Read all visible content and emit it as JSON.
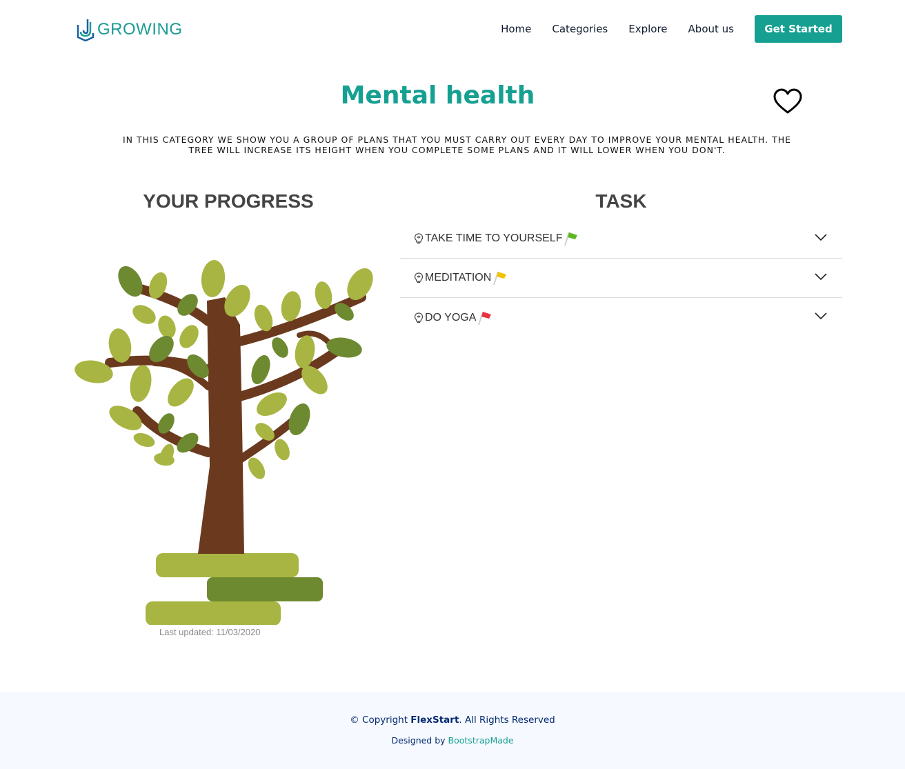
{
  "header": {
    "logo_text": "GROWING",
    "nav": [
      "Home",
      "Categories",
      "Explore",
      "About us"
    ],
    "cta_label": "Get Started"
  },
  "main": {
    "title": "Mental health",
    "intro": "IN THIS CATEGORY WE SHOW YOU A GROUP OF PLANS THAT YOU MUST CARRY OUT EVERY DAY TO IMPROVE YOUR MENTAL HEALTH. THE TREE WILL INCREASE ITS HEIGHT WHEN YOU COMPLETE SOME PLANS AND IT WILL LOWER WHEN YOU DON'T.",
    "progress_title": "YOUR PROGRESS",
    "last_updated": "Last updated: 11/03/2020",
    "task_title": "TASK",
    "tasks": [
      {
        "label": "TAKE TIME TO YOURSELF",
        "flag_color": "#5fb820",
        "icon": "brain-bulb-icon"
      },
      {
        "label": "MEDITATION",
        "flag_color": "#f2c300",
        "icon": "brain-bulb-icon"
      },
      {
        "label": "DO YOGA",
        "flag_color": "#e8343f",
        "icon": "brain-bulb-icon"
      }
    ]
  },
  "footer": {
    "copyright_prefix": "© Copyright",
    "brand": "FlexStart",
    "copyright_suffix": ". All Rights Reserved",
    "designed_by": "Designed by",
    "designer": "BootstrapMade"
  },
  "colors": {
    "accent": "#16a091",
    "trunk": "#6b3a1e",
    "leaf_light": "#a9b542",
    "leaf_dark": "#6e8a30"
  }
}
